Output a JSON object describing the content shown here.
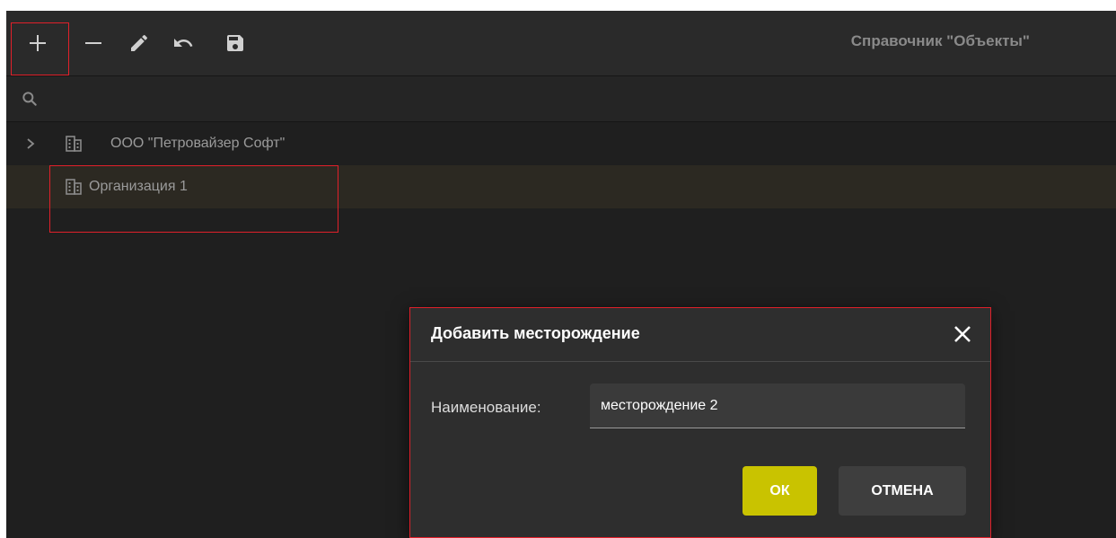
{
  "toolbar": {
    "title": "Справочник \"Объекты\"",
    "buttons": [
      {
        "name": "add",
        "icon": "plus-icon"
      },
      {
        "name": "remove",
        "icon": "minus-icon"
      },
      {
        "name": "edit",
        "icon": "pencil-icon"
      },
      {
        "name": "undo",
        "icon": "undo-icon"
      },
      {
        "name": "save",
        "icon": "floppy-disk-icon"
      }
    ]
  },
  "search": {
    "icon": "search-icon",
    "placeholder": ""
  },
  "tree": {
    "items": [
      {
        "label": "ООО \"Петровайзер Софт\"",
        "icon": "building-icon",
        "expandable": true,
        "selected": false
      },
      {
        "label": "Организация 1",
        "icon": "building-icon",
        "expandable": false,
        "selected": true
      }
    ]
  },
  "dialog": {
    "title": "Добавить месторождение",
    "field_label": "Наименование:",
    "field_value": "месторождение 2",
    "ok_label": "ОК",
    "cancel_label": "ОТМЕНА"
  },
  "colors": {
    "background": "#1f1f1f",
    "accent": "#c9c300",
    "highlight": "#e0202a",
    "selected_row": "#2c2922"
  }
}
